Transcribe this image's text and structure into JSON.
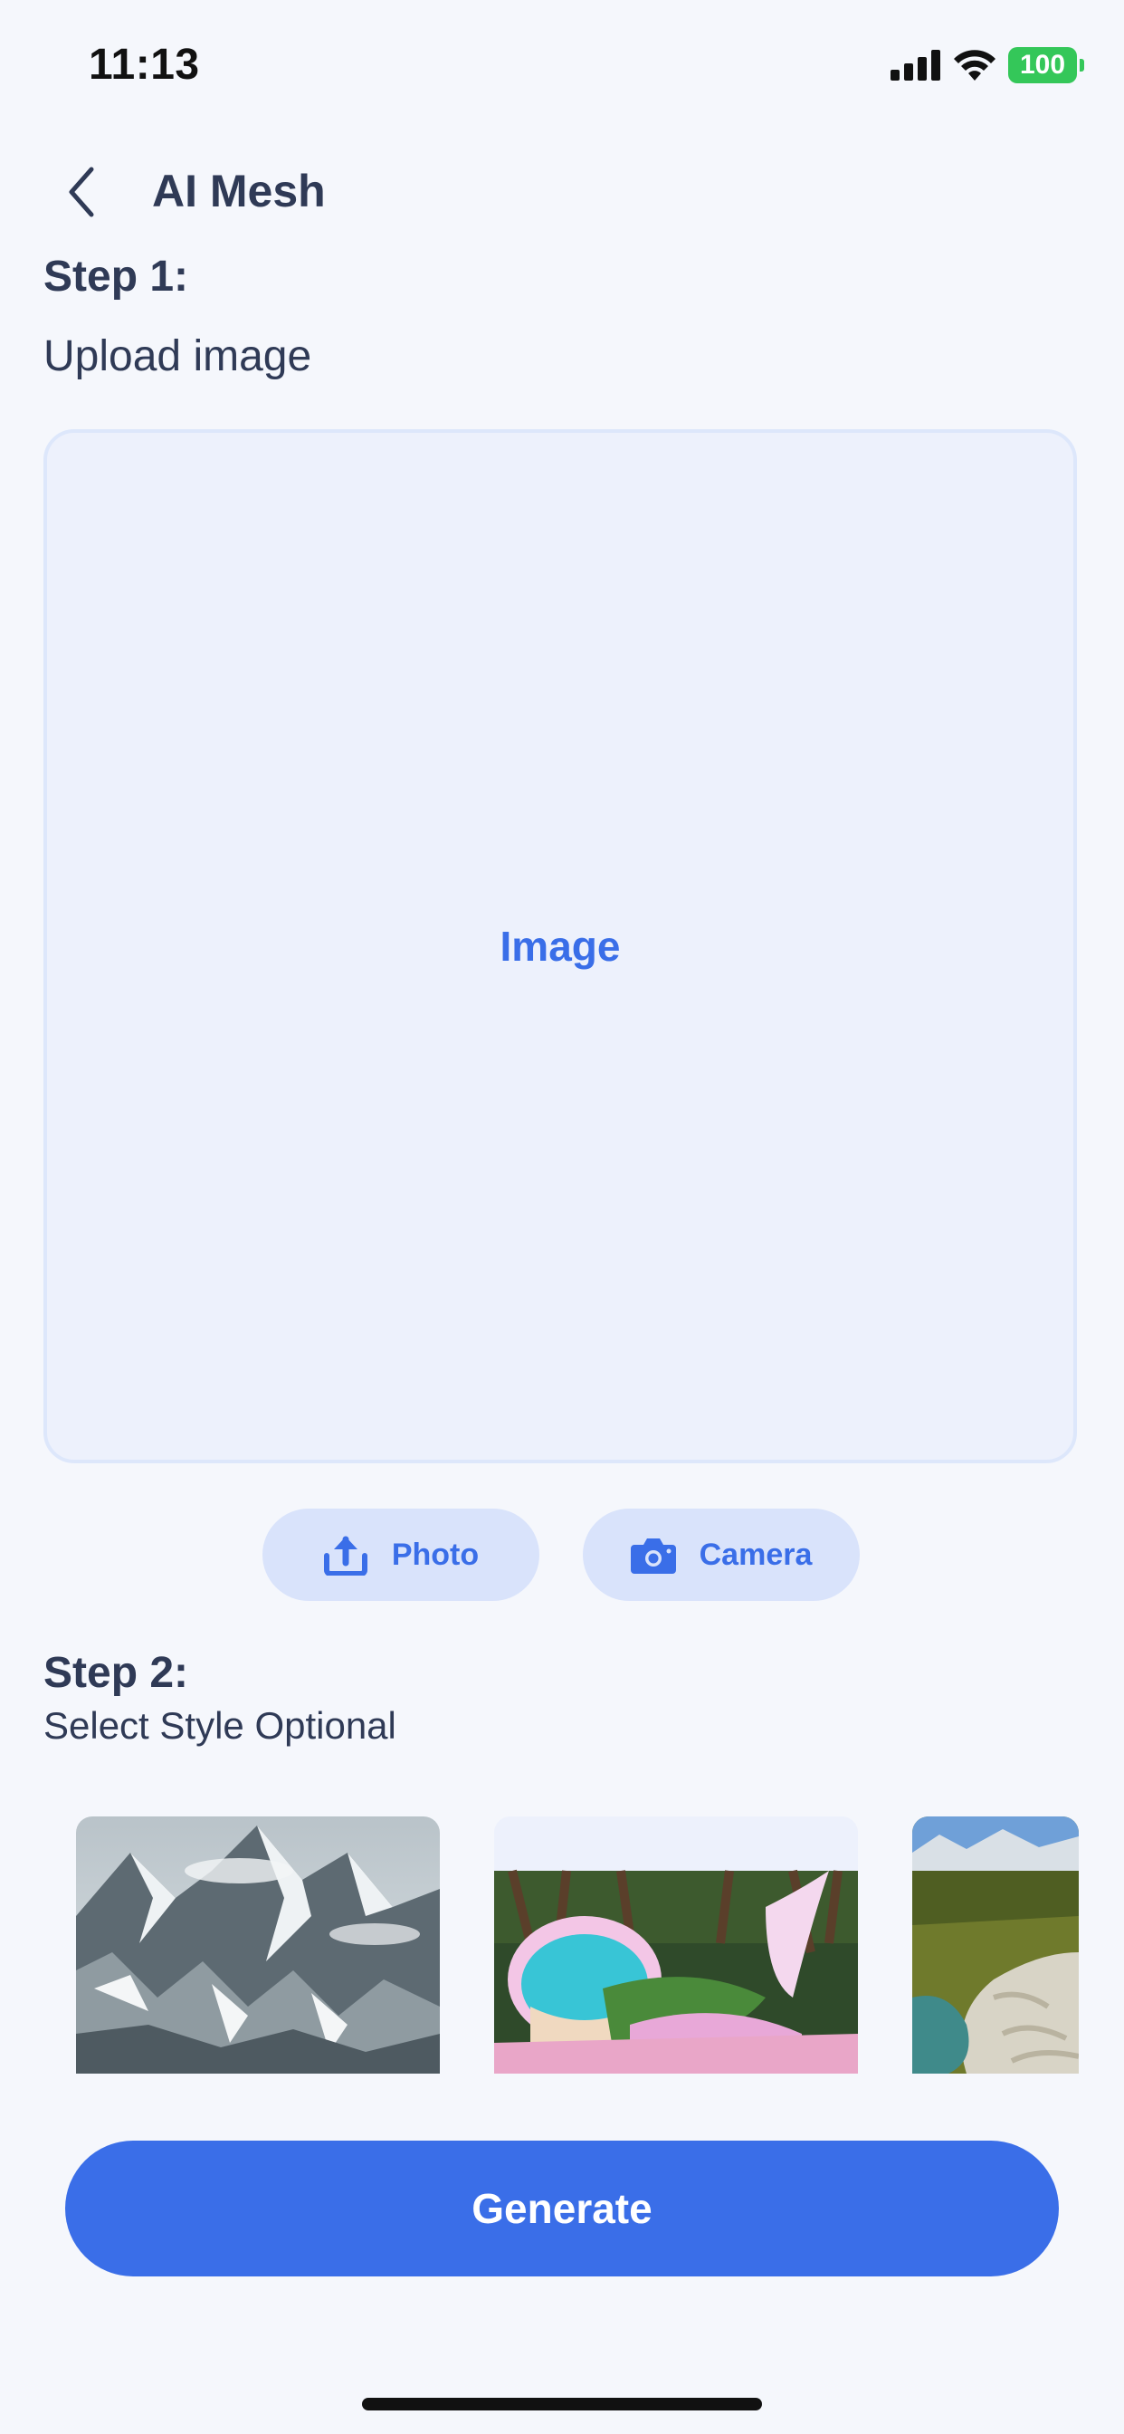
{
  "status_bar": {
    "time": "11:13",
    "battery": "100"
  },
  "nav": {
    "title": "AI Mesh",
    "back_icon": "chevron-left-icon"
  },
  "step1": {
    "title": "Step 1:",
    "subtitle": "Upload image",
    "placeholder": "Image"
  },
  "actions": {
    "photo": {
      "label": "Photo",
      "icon": "upload-icon"
    },
    "camera": {
      "label": "Camera",
      "icon": "camera-icon"
    }
  },
  "step2": {
    "title": "Step 2:",
    "subtitle": "Select Style Optional"
  },
  "styles": [
    {
      "name": "snowy-mountain"
    },
    {
      "name": "tropical-mermaid-tail"
    },
    {
      "name": "aerial-river-valley"
    }
  ],
  "generate_button": {
    "label": "Generate"
  },
  "colors": {
    "accent": "#3a6ee8",
    "pill_bg": "#d9e3fb",
    "page_bg": "#f5f7fc",
    "battery": "#34c759"
  }
}
